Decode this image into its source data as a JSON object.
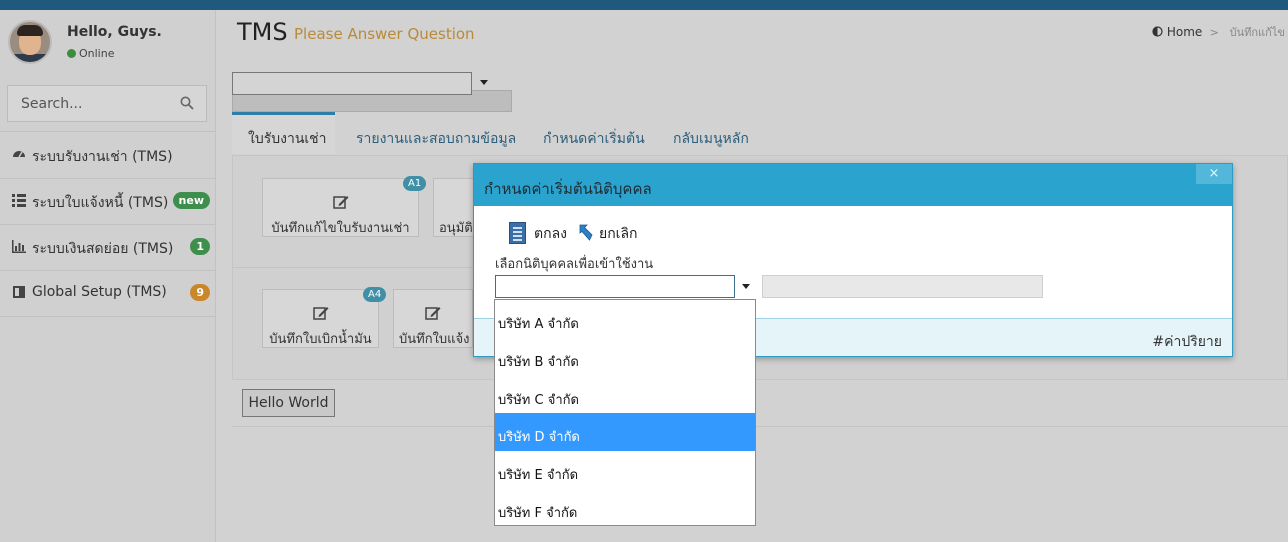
{
  "user": {
    "greeting": "Hello, Guys.",
    "status": "Online"
  },
  "search": {
    "placeholder": "Search..."
  },
  "menu": [
    {
      "label": "ระบบรับงานเช่า (TMS)",
      "icon": "dashboard-icon"
    },
    {
      "label": "ระบบใบแจ้งหนี้ (TMS)",
      "icon": "grid-icon",
      "badge": "new",
      "badge_color": "#3e8f4c"
    },
    {
      "label": "ระบบเงินสดย่อย (TMS)",
      "icon": "bar-chart-icon",
      "badge": "1",
      "badge_color": "#3e8f4c"
    },
    {
      "label": "Global Setup (TMS)",
      "icon": "book-icon",
      "badge": "9",
      "badge_color": "#c9872a"
    }
  ],
  "header": {
    "title": "TMS",
    "subtitle": "Please Answer Question"
  },
  "breadcrumb": {
    "home": "Home",
    "current": "บันทึกแก้ไข"
  },
  "tabs": [
    "ใบรับงานเช่า",
    "รายงานและสอบถามข้อมูล",
    "กำหนดค่าเริ่มต้น",
    "กลับเมนูหลัก"
  ],
  "tiles": [
    {
      "label": "บันทึกแก้ไขใบรับงานเช่า",
      "badge": "A1"
    },
    {
      "label": "อนุมัติ"
    },
    {
      "label": "บันทึกใบเบิกน้ำมัน",
      "badge": "A4"
    },
    {
      "label": "บันทึกใบแจ้ง"
    }
  ],
  "hello_button": "Hello World",
  "modal": {
    "title": "กำหนดค่าเริ่มต้นนิติบุคคล",
    "close": "×",
    "ok_label": "ตกลง",
    "cancel_label": "ยกเลิก",
    "field_label": "เลือกนิติบุคคลเพื่อเข้าใช้งาน",
    "footer": "#ค่าปริยาย"
  },
  "dropdown": {
    "options": [
      "บริษัท A จำกัด",
      "บริษัท B จำกัด",
      "บริษัท C จำกัด",
      "บริษัท D จำกัด",
      "บริษัท E จำกัด",
      "บริษัท F จำกัด"
    ],
    "highlighted_index": 3
  },
  "colors": {
    "accent": "#2aa4cf",
    "highlight": "#3399ff",
    "topbar": "#1f5a7e"
  }
}
